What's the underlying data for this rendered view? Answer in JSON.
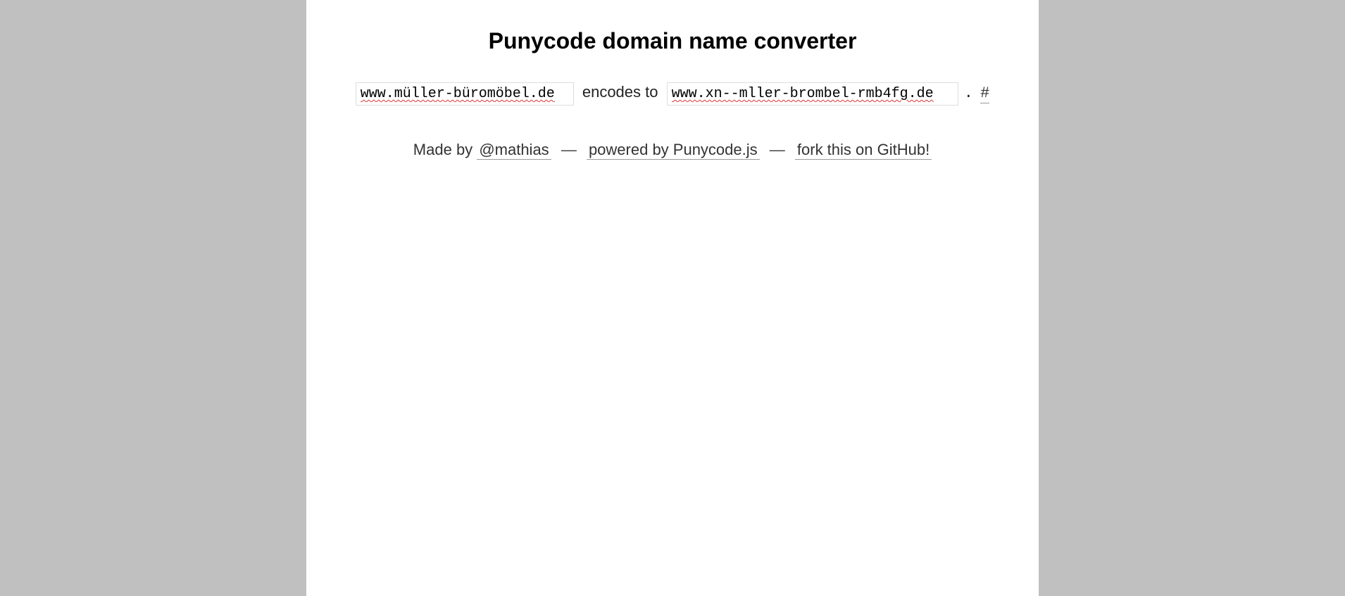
{
  "title": "Punycode domain name converter",
  "decoded_value": "www.müller-büromöbel.de",
  "mid_text": "encodes to",
  "encoded_value": "www.xn--mller-brombel-rmb4fg.de",
  "dot": ".",
  "permalink": "#",
  "footer": {
    "made_by": "Made by",
    "author": "@mathias",
    "sep": "—",
    "powered": "powered by Punycode.js",
    "fork": "fork this on GitHub!"
  }
}
